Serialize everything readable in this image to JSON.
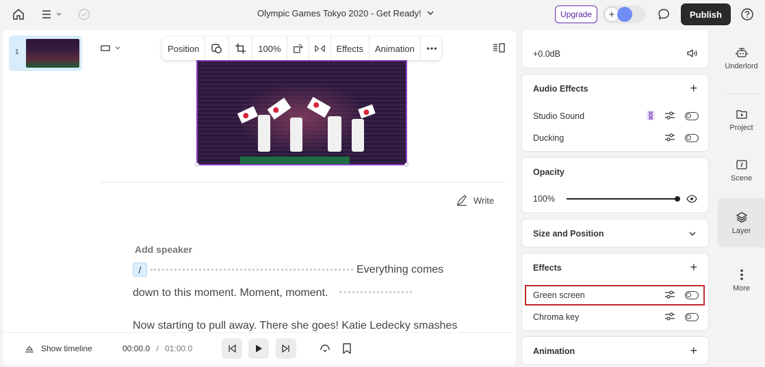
{
  "header": {
    "title": "Olympic Games Tokyo 2020 - Get Ready!",
    "upgrade_label": "Upgrade",
    "publish_label": "Publish"
  },
  "toolbar": {
    "position_label": "Position",
    "zoom_value": "100%",
    "effects_label": "Effects",
    "animation_label": "Animation"
  },
  "scenes": [
    {
      "number": "1"
    }
  ],
  "script": {
    "write_label": "Write",
    "add_speaker": "Add speaker",
    "slash": "/",
    "line1": "Everything comes",
    "line2": "down to this moment. Moment, moment.",
    "line3": "Now starting to pull away. There she goes! Katie Ledecky smashes"
  },
  "playback": {
    "show_timeline": "Show timeline",
    "current_time": "00:00.0",
    "separator": "/",
    "total_time": "01:00.0"
  },
  "properties": {
    "volume": "+0.0dB",
    "audio_effects": {
      "title": "Audio Effects",
      "items": [
        "Studio Sound",
        "Ducking"
      ]
    },
    "opacity": {
      "title": "Opacity",
      "value": "100%",
      "level": 1.0
    },
    "size_position": {
      "title": "Size and Position"
    },
    "effects": {
      "title": "Effects",
      "items": [
        "Green screen",
        "Chroma key"
      ]
    },
    "animation": {
      "title": "Animation"
    }
  },
  "sidebar": {
    "items": [
      {
        "label": "Underlord",
        "icon": "robot-icon"
      },
      {
        "label": "Project",
        "icon": "project-icon"
      },
      {
        "label": "Scene",
        "icon": "scene-icon"
      },
      {
        "label": "Layer",
        "icon": "layers-icon"
      },
      {
        "label": "More",
        "icon": "more-vertical-icon"
      }
    ]
  },
  "colors": {
    "accent_purple": "#8a3fc9",
    "highlight_red": "#c2272d",
    "publish_bg": "#2a2a2a",
    "selected_scene_bg": "#d8ecfb"
  }
}
